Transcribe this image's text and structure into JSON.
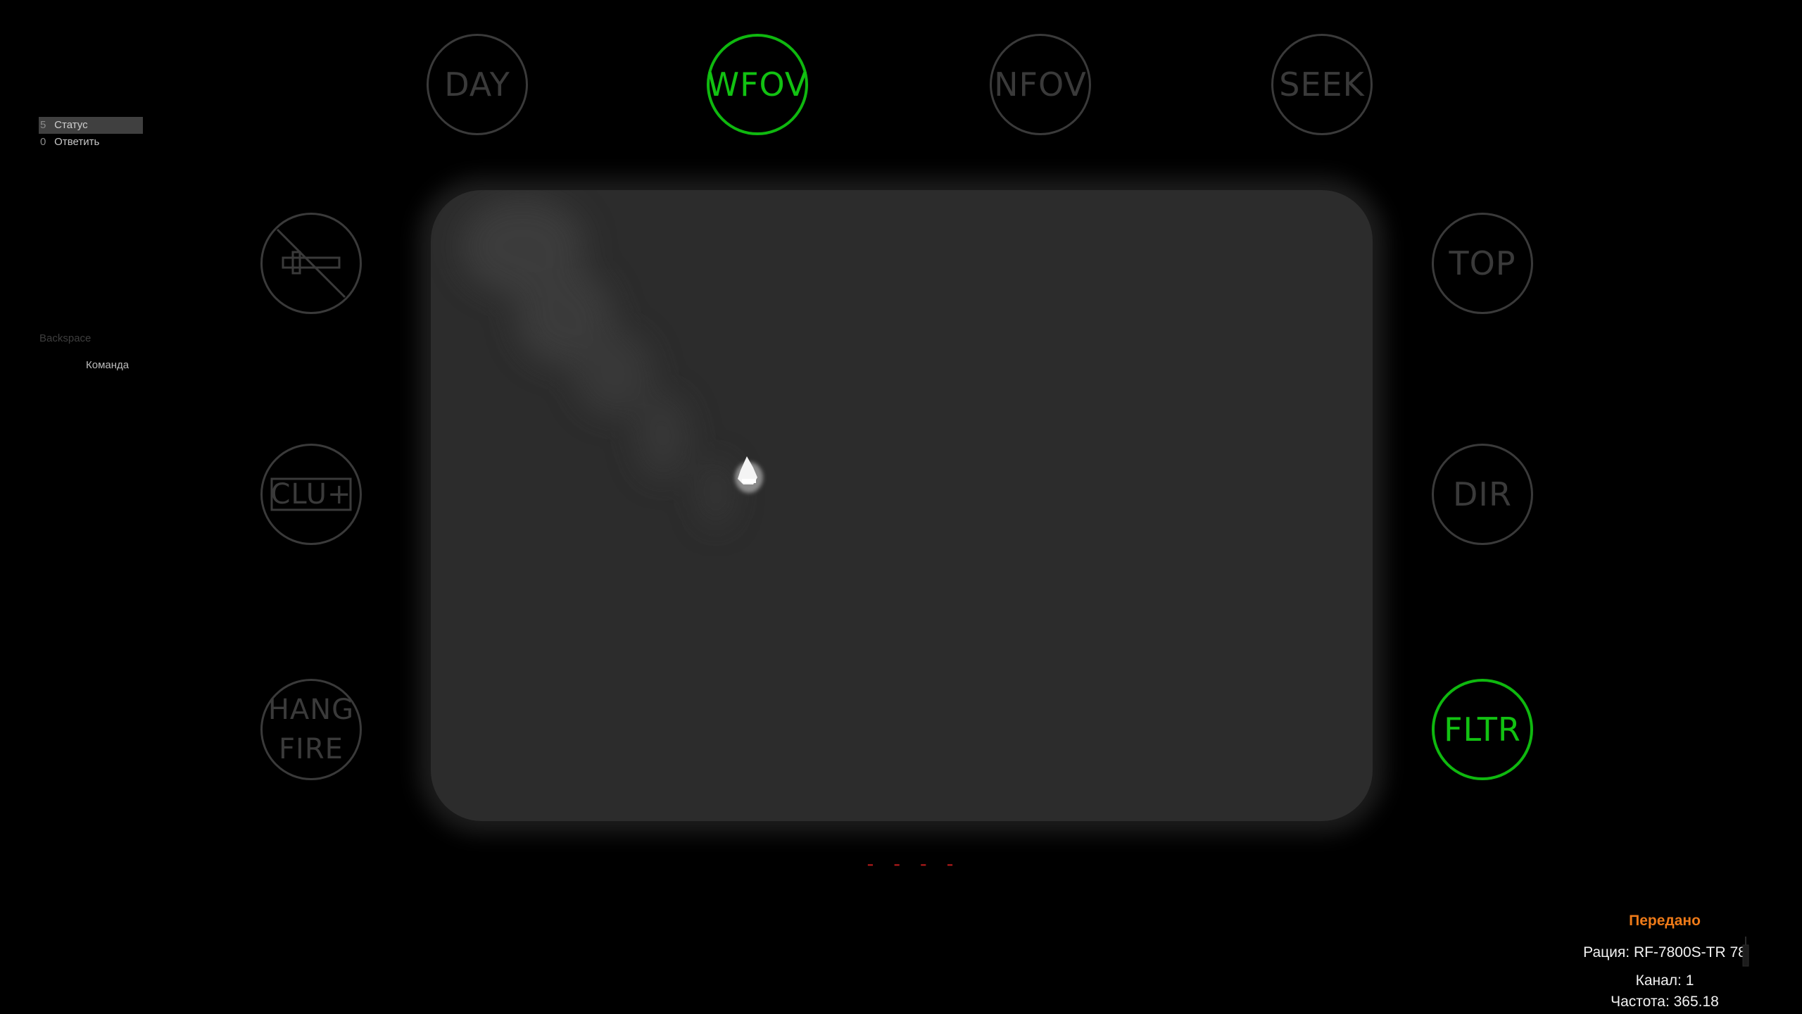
{
  "command_menu": {
    "items": [
      {
        "key": "5",
        "label": "Статус",
        "selected": true
      },
      {
        "key": "0",
        "label": "Ответить",
        "selected": false
      }
    ],
    "hint_key": "Backspace",
    "hint_label": "Команда"
  },
  "sight_buttons": {
    "day": "DAY",
    "wfov": "WFOV",
    "nfov": "NFOV",
    "seek": "SEEK",
    "top": "TOP",
    "dir": "DIR",
    "clu": "CLU+",
    "hang_fire_line1": "HANG",
    "hang_fire_line2": "FIRE",
    "fltr": "FLTR",
    "active": [
      "WFOV",
      "FLTR"
    ]
  },
  "range_readout": "- - - -",
  "radio": {
    "status": "Передано",
    "radio_label": "Рация: RF-7800S-TR 78",
    "channel_label": "Канал: 1",
    "frequency_label": "Частота: 365.18"
  },
  "colors": {
    "active_green": "#0fb80f",
    "inactive_gray": "#3a3a3a",
    "status_orange": "#ee7a18",
    "range_red": "#b01a1a",
    "viewport_gray": "#2c2c2c"
  }
}
